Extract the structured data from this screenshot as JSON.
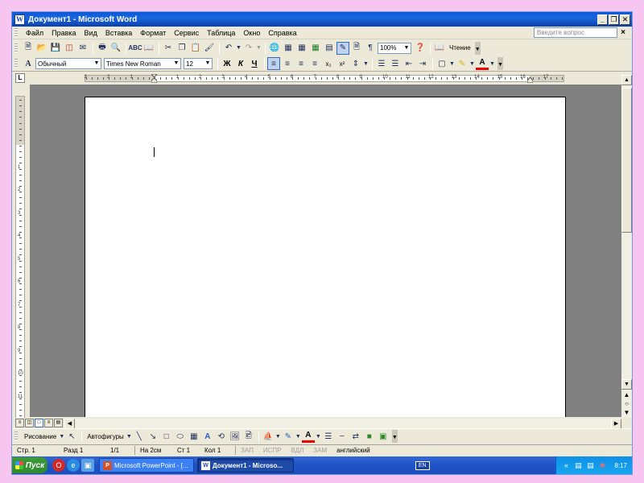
{
  "window": {
    "title": "Документ1 - Microsoft Word",
    "app_icon_letter": "W",
    "buttons": [
      "_",
      "❐",
      "✕"
    ]
  },
  "menubar": {
    "items": [
      "Файл",
      "Правка",
      "Вид",
      "Вставка",
      "Формат",
      "Сервис",
      "Таблица",
      "Окно",
      "Справка"
    ],
    "ask_placeholder": "Введите вопрос",
    "close_glyph": "×"
  },
  "standard_toolbar": {
    "zoom": "100%",
    "reading_label": "Чтение",
    "icons": [
      "new-doc",
      "open",
      "save",
      "permission",
      "email",
      "print",
      "print-preview",
      "spelling",
      "research",
      "cut",
      "copy",
      "paste",
      "format-painter",
      "undo",
      "redo",
      "hyperlink",
      "tables-borders",
      "insert-table",
      "insert-excel",
      "columns",
      "drawing",
      "document-map",
      "show-hide",
      "help"
    ]
  },
  "formatting_toolbar": {
    "style": "Обычный",
    "font": "Times New Roman",
    "size": "12",
    "bold": "Ж",
    "italic": "К",
    "underline": "Ч",
    "subscript": "x₂",
    "superscript": "x²"
  },
  "ruler": {
    "corner": "L",
    "h_labels": [
      "3",
      "2",
      "1",
      "1",
      "2",
      "3",
      "4",
      "5",
      "6",
      "7",
      "8",
      "9",
      "10",
      "11",
      "12",
      "13",
      "14",
      "15",
      "16",
      "17"
    ],
    "v_labels": [
      "1",
      "2",
      "3",
      "4",
      "5",
      "6",
      "7",
      "8",
      "9",
      "10",
      "11",
      "12",
      "13",
      "14"
    ]
  },
  "drawing_toolbar": {
    "drawing_label": "Рисование",
    "autoshapes_label": "Автофигуры"
  },
  "statusbar": {
    "page": "Стр. 1",
    "section": "Разд 1",
    "pages": "1/1",
    "at": "На 2см",
    "line": "Ст 1",
    "col": "Кол 1",
    "rec": "ЗАП",
    "trk": "ИСПР",
    "ext": "ВДЛ",
    "ovr": "ЗАМ",
    "language": "английский"
  },
  "taskbar": {
    "start_label": "Пуск",
    "tasks": [
      {
        "label": "Microsoft PowerPoint - [...",
        "active": false,
        "icon_letter": "P"
      },
      {
        "label": "Документ1 - Microso...",
        "active": true,
        "icon_letter": "W"
      }
    ],
    "language_indicator": "EN",
    "clock": "8:17"
  },
  "colors": {
    "background": "#f7c6f0",
    "titlebar": "#0a58e0",
    "taskbar": "#245edb",
    "start": "#3c9a3b"
  }
}
